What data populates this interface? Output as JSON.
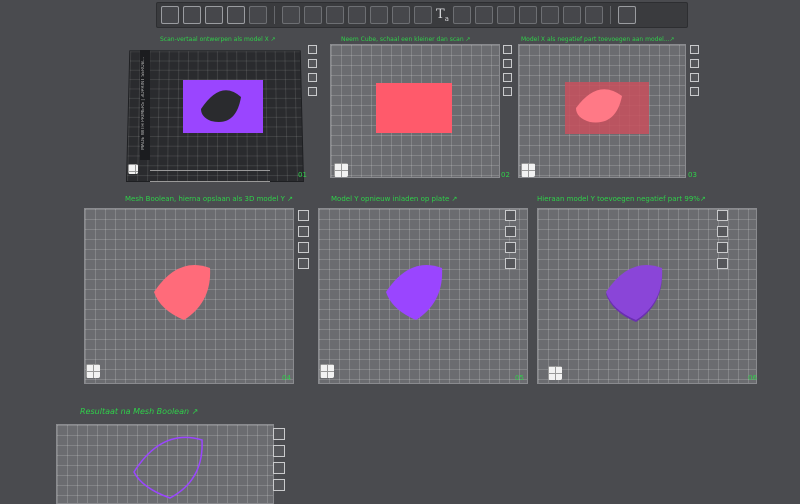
{
  "toolbar": {
    "text_tool_label": "T",
    "text_tool_sub": "a"
  },
  "plates": [
    {
      "caption": "Scan-vertaal ontwerpen als model X ↗",
      "number": "01"
    },
    {
      "caption": "Neem Cube, schaal een kleiner dan scan ↗",
      "number": "02"
    },
    {
      "caption": "Model X als negatief part toevoegen aan model...↗",
      "number": "03"
    },
    {
      "caption": "Mesh Boolean, hierna opslaan als 3D model Y ↗",
      "number": "04"
    },
    {
      "caption": "Model Y opnieuw inladen op plate ↗",
      "number": "05"
    },
    {
      "caption": "Hieraan model Y toevoegen negatief part 99%↗",
      "number": "06"
    },
    {
      "caption": "Resultaat na Mesh Boolean ↗",
      "number": ""
    }
  ],
  "plate1_side_text": "MADE WITH PRIMERS | 3DPRINT SEROB...",
  "colors": {
    "accent_text": "#2fd04a",
    "purple": "#9a45ff",
    "pink": "#ff5a6b"
  }
}
